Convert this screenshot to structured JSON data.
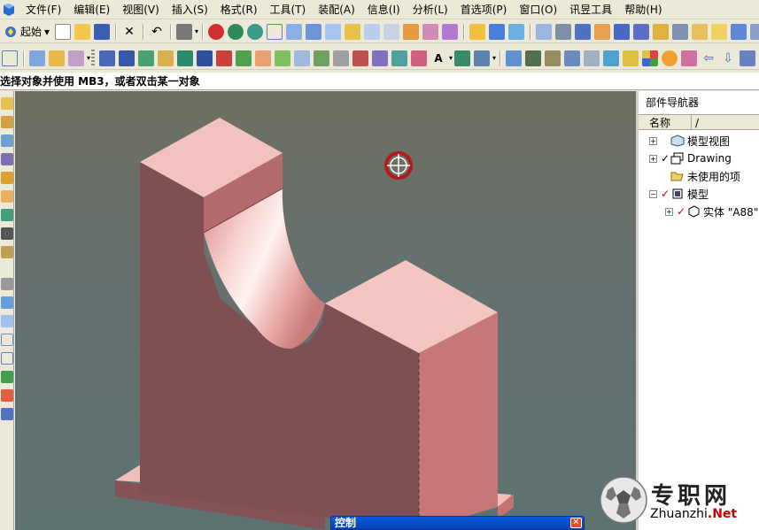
{
  "menu": {
    "items": [
      "文件(F)",
      "编辑(E)",
      "视图(V)",
      "插入(S)",
      "格式(R)",
      "工具(T)",
      "装配(A)",
      "信息(I)",
      "分析(L)",
      "首选项(P)",
      "窗口(O)",
      "讯昱工具",
      "帮助(H)"
    ]
  },
  "toolbar": {
    "start_label": "起始"
  },
  "status": {
    "prompt": "选择对象并使用 MB3，或者双击某一对象"
  },
  "navigator": {
    "title": "部件导航器",
    "column_name": "名称",
    "column_sort": "/",
    "tree": [
      {
        "label": "模型视图"
      },
      {
        "label": "Drawing"
      },
      {
        "label": "未使用的项"
      },
      {
        "label": "模型"
      },
      {
        "label": "实体 \"A88\""
      }
    ]
  },
  "dialog": {
    "title": "控制",
    "close": "✕"
  },
  "watermark": {
    "title": "专职网",
    "url_prefix": "Zhuanzhi",
    "url_suffix": ".Net"
  },
  "colors": {
    "part_top": "#f2c3be",
    "part_front": "#7e4f53",
    "part_side": "#c67776",
    "accent_red": "#cc0000"
  }
}
